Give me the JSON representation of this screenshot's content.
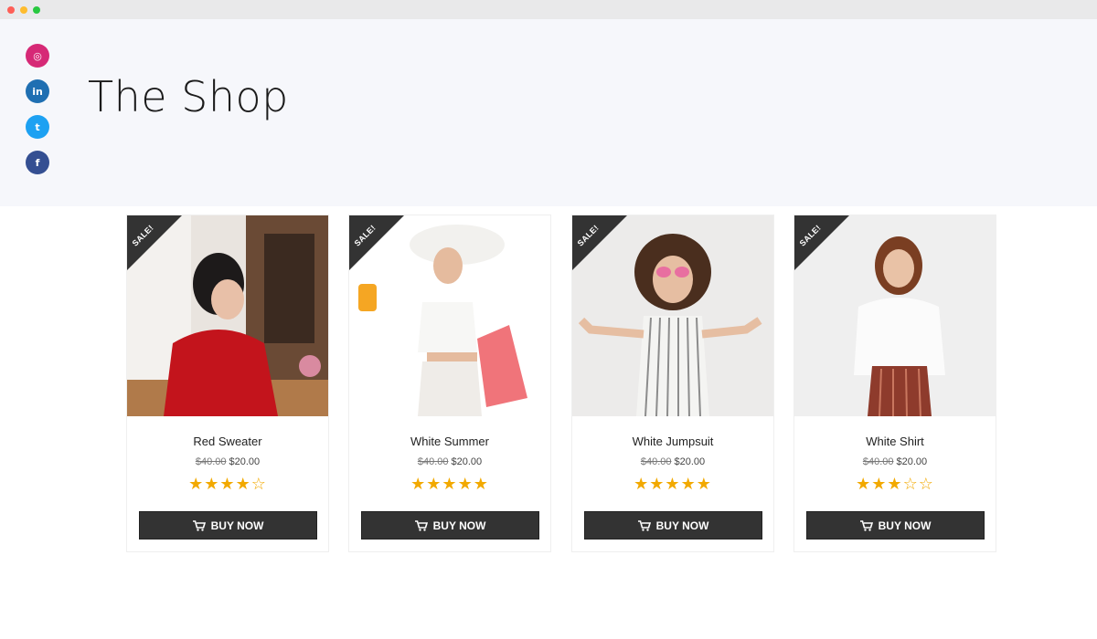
{
  "header": {
    "title": "The Shop"
  },
  "social": [
    {
      "name": "instagram",
      "glyph": "◎",
      "color": "#d62976"
    },
    {
      "name": "linkedin",
      "glyph": "in",
      "color": "#1f6fb2"
    },
    {
      "name": "twitter",
      "glyph": "t",
      "color": "#1da1f2"
    },
    {
      "name": "facebook",
      "glyph": "f",
      "color": "#344f92"
    }
  ],
  "products": [
    {
      "name": "Red Sweater",
      "old_price": "$40.00",
      "price": "$20.00",
      "rating": 4.5,
      "stars": "★★★★☆",
      "badge": "SALE!",
      "button": "BUY NOW"
    },
    {
      "name": "White Summer",
      "old_price": "$40.00",
      "price": "$20.00",
      "rating": 5,
      "stars": "★★★★★",
      "badge": "SALE!",
      "button": "BUY NOW"
    },
    {
      "name": "White Jumpsuit",
      "old_price": "$40.00",
      "price": "$20.00",
      "rating": 5,
      "stars": "★★★★★",
      "badge": "SALE!",
      "button": "BUY NOW"
    },
    {
      "name": "White Shirt",
      "old_price": "$40.00",
      "price": "$20.00",
      "rating": 3,
      "stars": "★★★☆☆",
      "badge": "SALE!",
      "button": "BUY NOW"
    }
  ],
  "colors": {
    "accent_star": "#f2a900",
    "button_bg": "#333333",
    "badge_bg": "#333333",
    "hero_bg": "#f6f7fb"
  }
}
